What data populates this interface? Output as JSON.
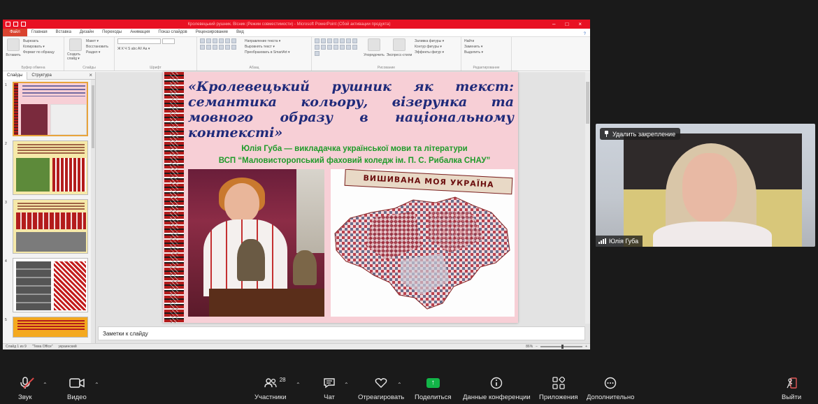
{
  "ppt": {
    "window_title": "Кролевецький рушник. Вісник (Режим совместимости) - Microsoft PowerPoint (Сбой активации продукта)",
    "tabs": [
      "Файл",
      "Главная",
      "Вставка",
      "Дизайн",
      "Переходы",
      "Анимация",
      "Показ слайдов",
      "Рецензирование",
      "Вид"
    ],
    "ribbon_groups": [
      {
        "label": "Буфер обмена",
        "lines": [
          "Вырезать",
          "Копировать ▾",
          "Формат по образцу"
        ],
        "big": "Вставить"
      },
      {
        "label": "Слайды",
        "lines": [
          "Макет ▾",
          "Восстановить",
          "Раздел ▾"
        ],
        "big": "Создать слайд ▾"
      },
      {
        "label": "Шрифт",
        "lines": [
          "",
          "Ж К Ч S abc AV Aa ▾",
          "A ▾"
        ]
      },
      {
        "label": "Абзац",
        "lines": [
          "Направление текста ▾",
          "Выровнять текст ▾",
          "Преобразовать в SmartArt ▾"
        ]
      },
      {
        "label": "Рисование",
        "lines": [
          "Заливка фигуры ▾",
          "Контур фигуры ▾",
          "Эффекты фигур ▾"
        ],
        "extra": [
          "Упорядочить",
          "Экспресс-стили"
        ]
      },
      {
        "label": "Редактирование",
        "lines": [
          "Найти",
          "Заменить ▾",
          "Выделить ▾"
        ]
      }
    ],
    "left_panel": {
      "tabs": [
        "Слайды",
        "Структура"
      ],
      "close": "×",
      "thumb_numbers": [
        "1",
        "2",
        "3",
        "4",
        "5"
      ]
    },
    "slide": {
      "title": "«Кролевецький рушник як текст: семантика кольору, візерунка та мовного образу в національному контексті»",
      "author_line1": "Юлія Губа — викладачка української мови та літератури",
      "author_line2": "ВСП  “Маловисторопський фаховий   коледж  ім. П. С. Рибалка СНАУ”",
      "map_banner": "ВИШИВАНА МОЯ УКРАЇНА"
    },
    "notes_placeholder": "Заметки к слайду",
    "status": {
      "slide": "Слайд 1 из 9",
      "theme": "\"Тема Office\"",
      "lang": "украинский",
      "zoom": "86%"
    }
  },
  "video": {
    "unpin_label": "Удалить закрепление",
    "name": "Юлія Губа"
  },
  "toolbar": {
    "audio": "Звук",
    "video": "Видео",
    "participants": "Участники",
    "participants_count": "28",
    "chat": "Чат",
    "react": "Отреагировать",
    "share": "Поделиться",
    "info": "Данные конференции",
    "apps": "Приложения",
    "more": "Дополнительно",
    "leave": "Выйти"
  },
  "colors": {
    "ppt_accent": "#e81123",
    "share_green": "#12b548",
    "title_blue": "#1f2a7a",
    "author_green": "#1f9b2a",
    "slide_bg": "#f7cfd6"
  }
}
